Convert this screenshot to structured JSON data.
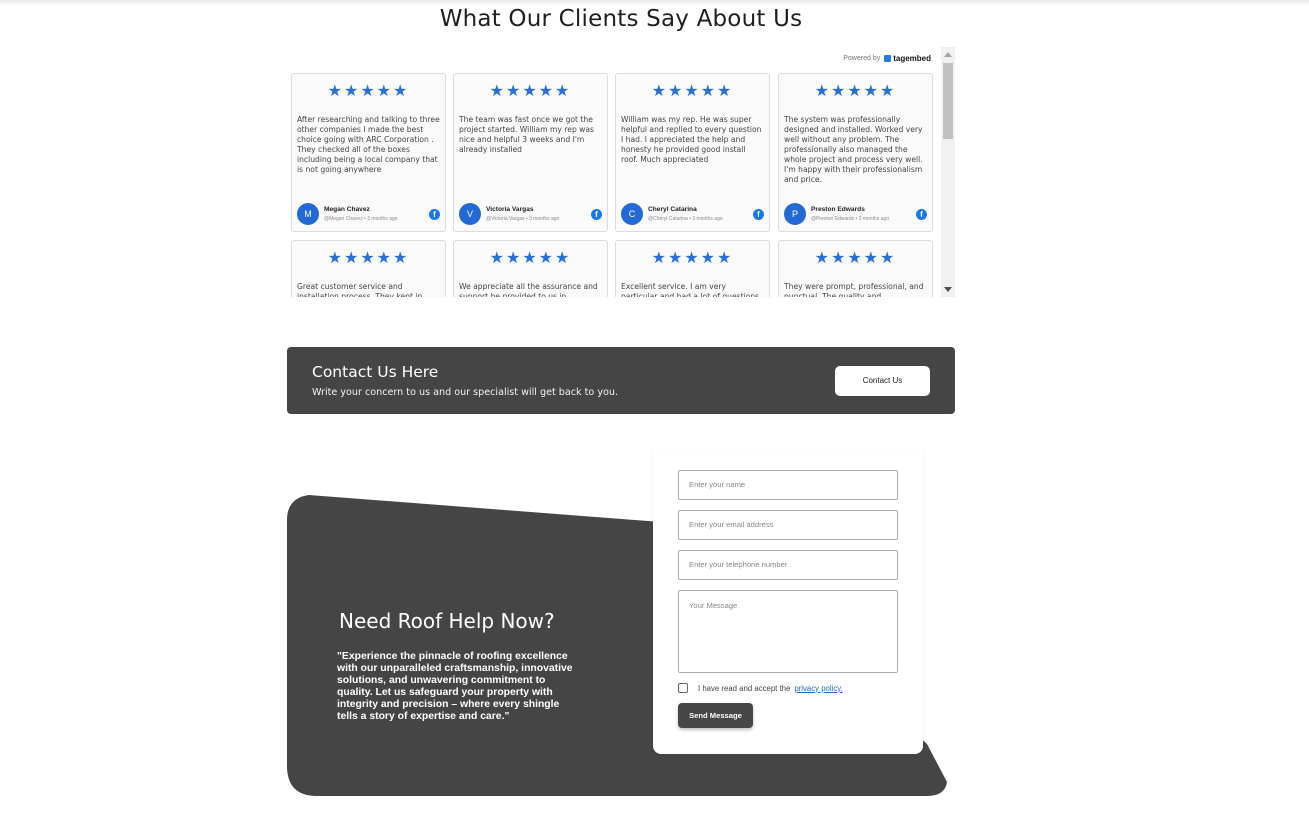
{
  "testimonials": {
    "heading": "What Our Clients Say About Us",
    "powered_by": "Powered by",
    "brand": "tagembed",
    "stars": "★★★★★",
    "reviews": [
      {
        "text": "After researching and talking to three other companies I made the best choice going with ARC Corporation . They checked all of the boxes including being a local company that is not going anywhere",
        "initial": "M",
        "name": "Megan Chavez",
        "handle": "@Megan Chavez",
        "time": "3 months ago"
      },
      {
        "text": "The team was fast once we got the project started. William my rep was nice and helpful 3 weeks and I'm already installed",
        "initial": "V",
        "name": "Victoria Vargas",
        "handle": "@Victoria Vargas",
        "time": "3 months ago"
      },
      {
        "text": "William was my rep. He was super helpful and replied to every question I had. I appreciated the help and honesty he provided good install roof. Much appreciated",
        "initial": "C",
        "name": "Cheryl Catarina",
        "handle": "@Cheryl Catarina",
        "time": "3 months ago"
      },
      {
        "text": "The system was professionally designed and installed. Worked very well without any problem. The professionally also managed the whole project and process very well.\nI'm happy with their professionalism and price.",
        "initial": "P",
        "name": "Preston Edwards",
        "handle": "@Preston Edwards",
        "time": "3 months ago"
      },
      {
        "text": "Great customer service and installation process. They kept in",
        "initial": "",
        "name": "",
        "handle": "",
        "time": ""
      },
      {
        "text": "We appreciate all the assurance and support he provided to us in",
        "initial": "",
        "name": "",
        "handle": "",
        "time": ""
      },
      {
        "text": "Excellent service. I am very particular and had a lot of questions",
        "initial": "",
        "name": "",
        "handle": "",
        "time": ""
      },
      {
        "text": "They were prompt, professional, and punctual. The quality and",
        "initial": "",
        "name": "",
        "handle": "",
        "time": ""
      }
    ]
  },
  "contact_banner": {
    "title": "Contact Us Here",
    "subtitle": "Write your concern to us and our specialist will get back to you.",
    "button": "Contact Us"
  },
  "roof_help": {
    "title": "Need Roof Help Now?",
    "text": "\"Experience the pinnacle of roofing excellence with our unparalleled craftsmanship, innovative solutions, and unwavering commitment to quality. Let us safeguard your property with integrity and precision – where every shingle tells a story of expertise and care.\""
  },
  "form": {
    "name_placeholder": "Enter your name",
    "email_placeholder": "Enter your email address",
    "phone_placeholder": "Enter your telephone number",
    "message_placeholder": "Your Message",
    "consent_text": "I have read and accept the",
    "privacy_link": "privacy policy.",
    "submit": "Send Message"
  },
  "colors": {
    "dark": "#454545",
    "star_blue": "#2a6fd6",
    "facebook": "#1877f2"
  }
}
